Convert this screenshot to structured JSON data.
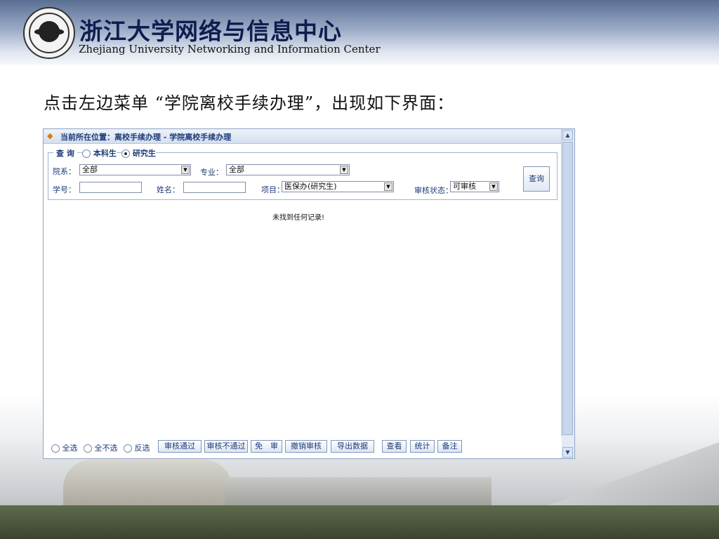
{
  "header": {
    "org_name_cn": "浙江大学网络与信息中心",
    "org_name_en": "Zhejiang University Networking and Information Center"
  },
  "instruction": "点击左边菜单 “学院离校手续办理”，出现如下界面：",
  "app": {
    "title": "当前所在位置：离校手续办理 - 学院离校手续办理",
    "query": {
      "legend": "查 询",
      "student_types": [
        {
          "label": "本科生",
          "selected": false
        },
        {
          "label": "研究生",
          "selected": true
        }
      ],
      "department_label": "院系：",
      "department_value": "全部",
      "major_label": "专业：",
      "major_value": "全部",
      "student_id_label": "学号：",
      "student_id_value": "",
      "name_label": "姓名：",
      "name_value": "",
      "project_label": "项目：",
      "project_value": "医保办(研究生)",
      "review_status_label": "审核状态：",
      "review_status_value": "可审核",
      "query_button": "查询"
    },
    "empty_message": "未找到任何记录!",
    "footer": {
      "select_options": [
        "全选",
        "全不选",
        "反选"
      ],
      "buttons": [
        "审核通过",
        "审核不通过",
        "免　审",
        "撤销审核",
        "导出数据",
        "查看",
        "统计",
        "备注"
      ]
    }
  }
}
